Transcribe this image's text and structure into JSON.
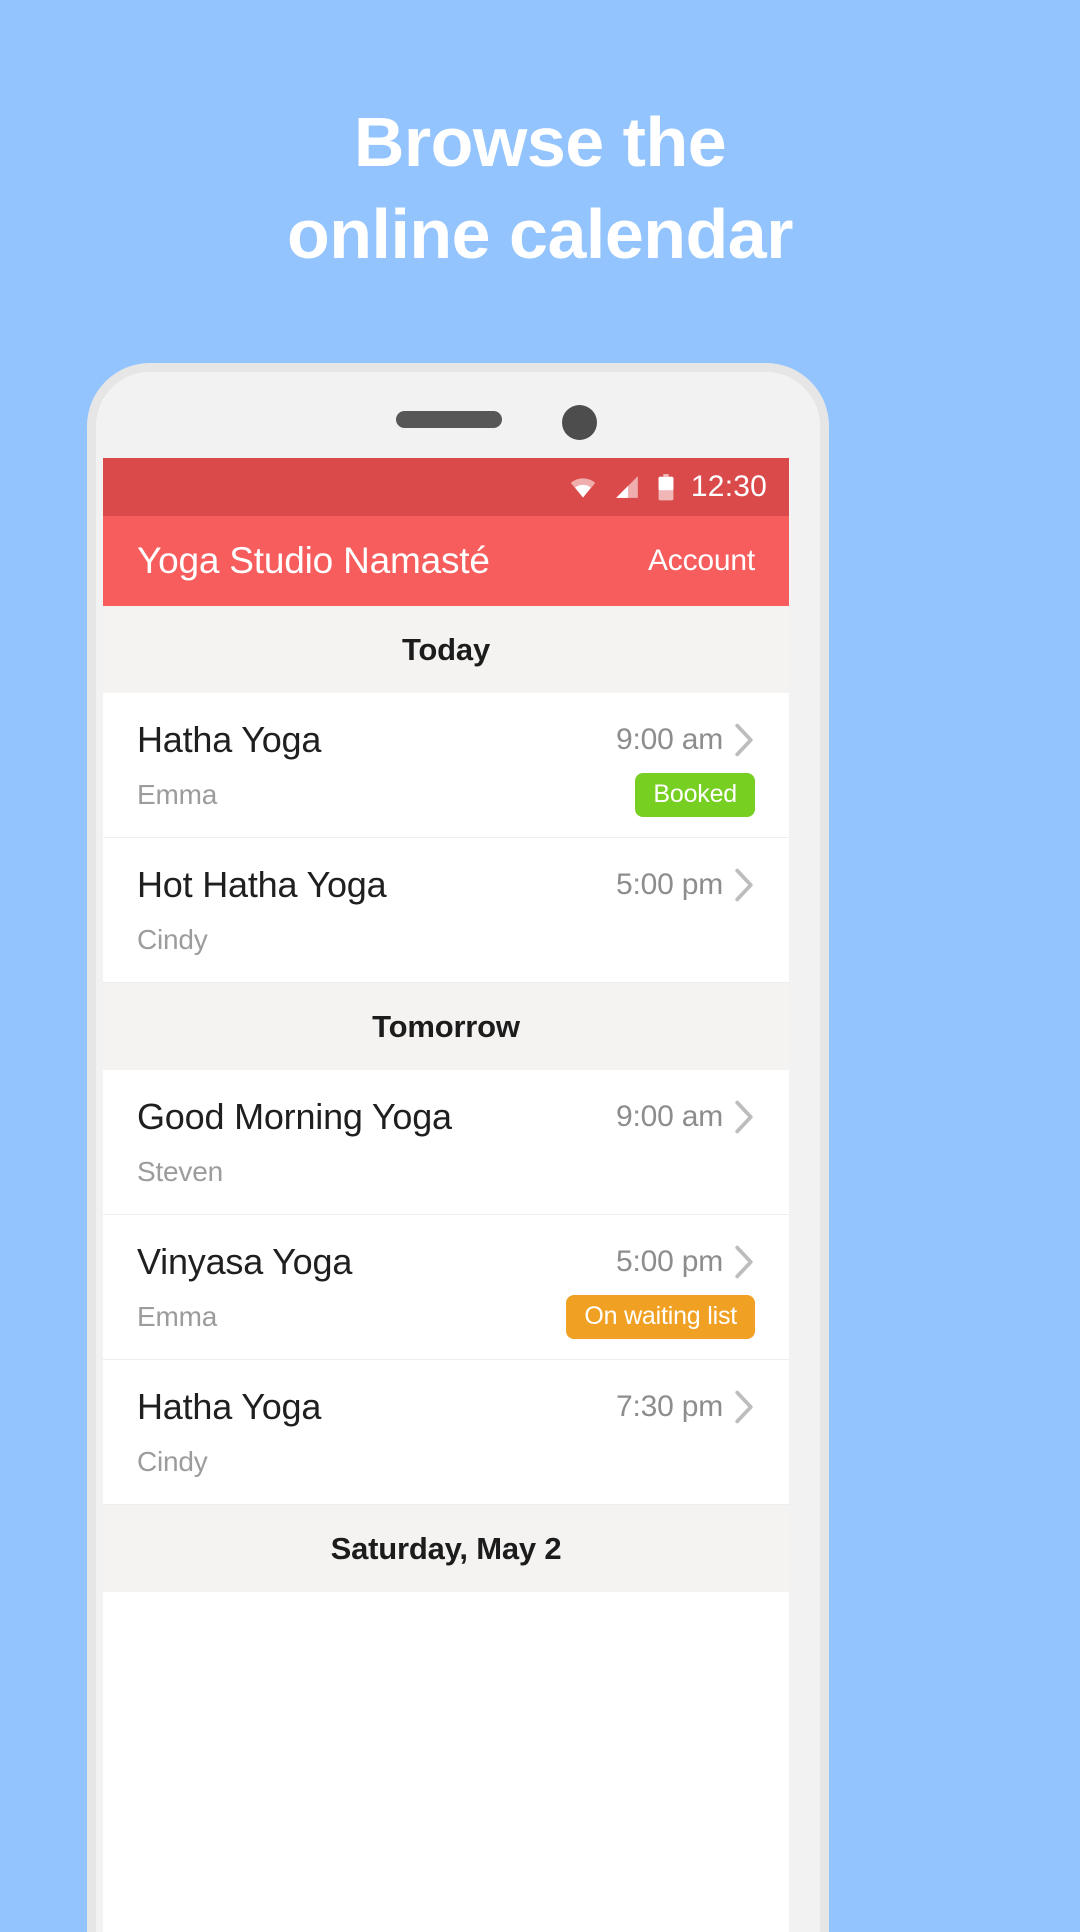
{
  "promo": {
    "headline_lines": [
      "Browse the",
      "online calendar"
    ],
    "background_color": "#93c4fd",
    "text_color": "#ffffff"
  },
  "phone": {
    "speaker_icon": "speaker-grill",
    "camera_icon": "front-camera"
  },
  "status_bar": {
    "time": "12:30",
    "wifi_icon": "wifi-icon",
    "signal_icon": "cellular-signal-icon",
    "battery_icon": "battery-icon",
    "background_color": "#db4a4a"
  },
  "app_bar": {
    "title": "Yoga Studio Namasté",
    "account_label": "Account",
    "background_color": "#f75d5d"
  },
  "colors": {
    "accent": "#f75d5d",
    "booked_badge": "#76cf21",
    "waiting_badge": "#f0a124"
  },
  "sections": [
    {
      "header": "Today",
      "classes": [
        {
          "name": "Hatha Yoga",
          "time": "9:00 am",
          "teacher": "Emma",
          "badge": "Booked",
          "badge_type": "booked",
          "chevron_icon": "chevron-right-icon"
        },
        {
          "name": "Hot Hatha Yoga",
          "time": "5:00 pm",
          "teacher": "Cindy",
          "badge": "",
          "badge_type": "none",
          "chevron_icon": "chevron-right-icon"
        }
      ]
    },
    {
      "header": "Tomorrow",
      "classes": [
        {
          "name": "Good Morning Yoga",
          "time": "9:00 am",
          "teacher": "Steven",
          "badge": "",
          "badge_type": "none",
          "chevron_icon": "chevron-right-icon"
        },
        {
          "name": "Vinyasa Yoga",
          "time": "5:00 pm",
          "teacher": "Emma",
          "badge": "On waiting list",
          "badge_type": "waiting",
          "chevron_icon": "chevron-right-icon"
        },
        {
          "name": "Hatha Yoga",
          "time": "7:30 pm",
          "teacher": "Cindy",
          "badge": "",
          "badge_type": "none",
          "chevron_icon": "chevron-right-icon"
        }
      ]
    },
    {
      "header": "Saturday, May 2",
      "classes": []
    }
  ]
}
